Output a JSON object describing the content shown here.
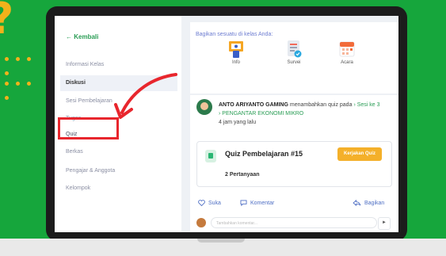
{
  "decor": {
    "glyph": "?"
  },
  "sidebar": {
    "back_label": "Kembali",
    "items": [
      {
        "label": "Informasi Kelas"
      },
      {
        "label": "Diskusi"
      },
      {
        "label": "Sesi Pembelajaran"
      },
      {
        "label": "Tugas"
      },
      {
        "label": "Quiz"
      },
      {
        "label": "Berkas"
      },
      {
        "label": "Pengajar & Anggota"
      },
      {
        "label": "Kelompok"
      }
    ]
  },
  "share": {
    "title": "Bagikan sesuatu di kelas Anda:",
    "options": [
      {
        "label": "Info",
        "icon": "info-board-icon"
      },
      {
        "label": "Survei",
        "icon": "survey-clipboard-icon"
      },
      {
        "label": "Acara",
        "icon": "calendar-icon"
      }
    ]
  },
  "post": {
    "author": "ANTO ARIYANTO GAMING",
    "action": "menambahkan quiz pada",
    "session": "Sesi ke 3",
    "course": "PENGANTAR EKONOMI MIKRO",
    "time": "4 jam yang lalu"
  },
  "quiz": {
    "title": "Quiz Pembelajaran #15",
    "button_label": "Kerjakan Quiz",
    "questions": "2 Pertanyaan"
  },
  "actions": {
    "like": "Suka",
    "comment": "Komentar",
    "share": "Bagikan"
  },
  "comment": {
    "placeholder": "Tambahkan komentar..."
  },
  "colors": {
    "background": "#16a63c",
    "accent": "#2a9d55",
    "highlight": "#e8262d",
    "button": "#f4b02a"
  }
}
